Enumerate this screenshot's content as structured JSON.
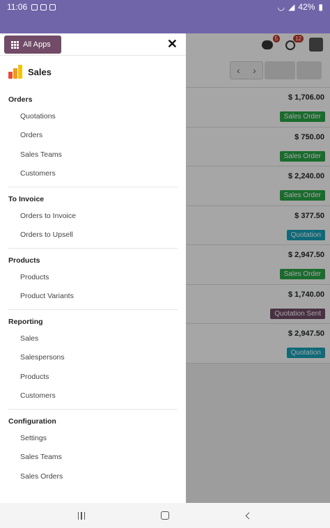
{
  "status_bar": {
    "time": "11:06",
    "battery": "42%"
  },
  "header": {
    "messages_badge": "5",
    "activities_badge": "12"
  },
  "background_list": {
    "rows": [
      {
        "amount": "$ 1,706.00",
        "status": "Sales Order",
        "color": "#28a745"
      },
      {
        "amount": "$ 750.00",
        "status": "Sales Order",
        "color": "#28a745"
      },
      {
        "amount": "$ 2,240.00",
        "status": "Sales Order",
        "color": "#28a745"
      },
      {
        "amount": "$ 377.50",
        "status": "Quotation",
        "color": "#17a2b8"
      },
      {
        "amount": "$ 2,947.50",
        "status": "Sales Order",
        "color": "#28a745"
      },
      {
        "amount": "$ 1,740.00",
        "status": "Quotation Sent",
        "color": "#714b67"
      },
      {
        "amount": "$ 2,947.50",
        "status": "Quotation",
        "color": "#17a2b8"
      }
    ]
  },
  "drawer": {
    "all_apps_label": "All Apps",
    "app_name": "Sales",
    "sections": [
      {
        "title": "Orders",
        "items": [
          "Quotations",
          "Orders",
          "Sales Teams",
          "Customers"
        ]
      },
      {
        "title": "To Invoice",
        "items": [
          "Orders to Invoice",
          "Orders to Upsell"
        ]
      },
      {
        "title": "Products",
        "items": [
          "Products",
          "Product Variants"
        ]
      },
      {
        "title": "Reporting",
        "items": [
          "Sales",
          "Salespersons",
          "Products",
          "Customers"
        ]
      },
      {
        "title": "Configuration",
        "items": [
          "Settings",
          "Sales Teams",
          "Sales Orders"
        ]
      }
    ]
  },
  "colors": {
    "brand_purple": "#7165a9",
    "all_apps_bg": "#714b67"
  },
  "icons": {
    "grid": "grid-icon",
    "close": "close-icon",
    "app_logo": "sales-app-icon"
  }
}
